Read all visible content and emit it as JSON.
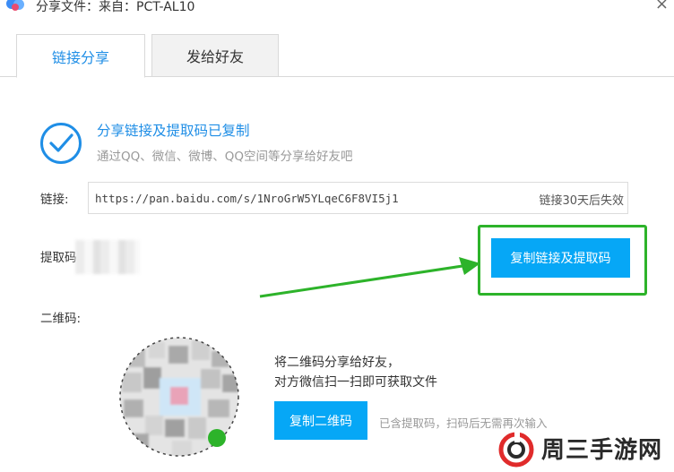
{
  "window": {
    "title": "分享文件：来自：PCT-AL10",
    "close_glyph": "×"
  },
  "tabs": [
    {
      "label": "链接分享",
      "active": true
    },
    {
      "label": "发给好友",
      "active": false
    }
  ],
  "success": {
    "title": "分享链接及提取码已复制",
    "subtitle": "通过QQ、微信、微博、QQ空间等分享给好友吧"
  },
  "link": {
    "label": "链接:",
    "url": "https://pan.baidu.com/s/1NroGrW5YLqeC6F8VI5j1",
    "expiry": "链接30天后失效"
  },
  "code": {
    "label": "提取码"
  },
  "copy_button": {
    "label": "复制链接及提取码"
  },
  "qr": {
    "label": "二维码:",
    "line1": "将二维码分享给好友，",
    "line2": "对方微信扫一扫即可获取文件",
    "button": "复制二维码",
    "note": "已含提取码，扫码后无需再次输入"
  },
  "watermark": {
    "text": "周三手游网"
  },
  "colors": {
    "accent": "#1f8ee6",
    "button": "#06a7f6",
    "highlight": "#2db32a",
    "muted": "#999999"
  }
}
